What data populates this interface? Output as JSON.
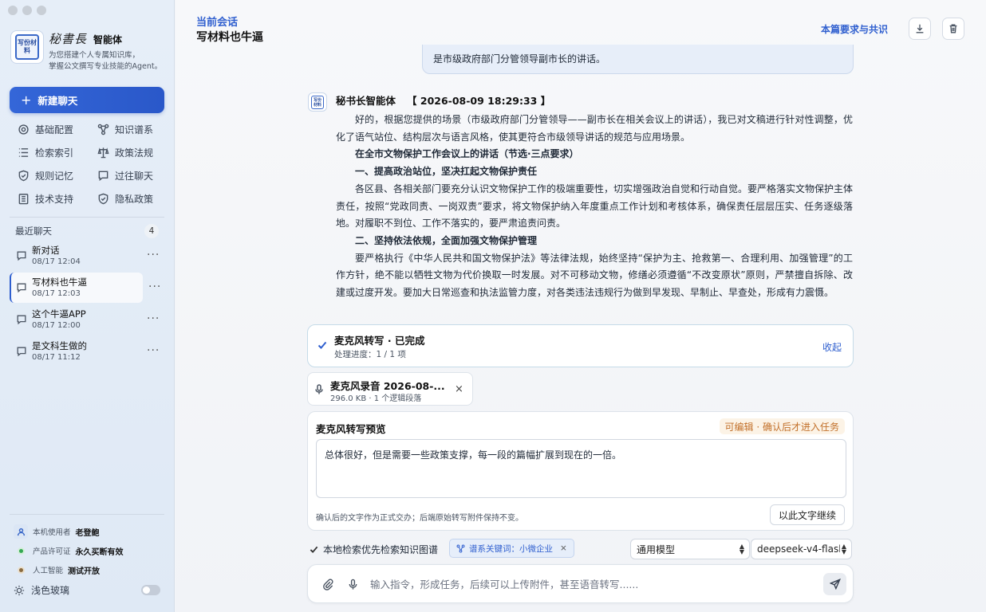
{
  "brand": {
    "logo_text": "写份材料",
    "script_name": "秘書長",
    "agent_label": "智能体",
    "description_line1": "为您搭建个人专属知识库，",
    "description_line2": "掌握公文撰写专业技能的Agent。"
  },
  "sidebar": {
    "new_chat_label": "新建聊天",
    "nav": [
      {
        "label": "基础配置",
        "icon": "gear-icon"
      },
      {
        "label": "知识谱系",
        "icon": "graph-icon"
      },
      {
        "label": "检索索引",
        "icon": "list-icon"
      },
      {
        "label": "政策法规",
        "icon": "scale-icon"
      },
      {
        "label": "规则记忆",
        "icon": "shield-icon"
      },
      {
        "label": "过往聊天",
        "icon": "chat-icon"
      },
      {
        "label": "技术支持",
        "icon": "building-icon"
      },
      {
        "label": "隐私政策",
        "icon": "shield-check-icon"
      }
    ],
    "recent_label": "最近聊天",
    "recent_count": "4",
    "chats": [
      {
        "title": "新对话",
        "time": "08/17 12:04"
      },
      {
        "title": "写材料也牛逼",
        "time": "08/17 12:03"
      },
      {
        "title": "这个牛逼APP",
        "time": "08/17 12:00"
      },
      {
        "title": "是文科生做的",
        "time": "08/17 11:12"
      }
    ],
    "more_label": "···",
    "footer": {
      "user_label": "本机使用者",
      "user_value": "老登鲍",
      "license_label": "产品许可证",
      "license_value": "永久买断有效",
      "ai_label": "人工智能",
      "ai_value": "测试开放",
      "theme_label": "浅色玻璃"
    }
  },
  "header": {
    "subtitle": "当前会话",
    "title": "写材料也牛逼",
    "requirements_link": "本篇要求与共识"
  },
  "conversation": {
    "previous_bubble": "是市级政府部门分管领导副市长的讲话。",
    "assistant_name": "秘书长智能体",
    "timestamp": "【 2026-08-09 18:29:33 】",
    "paragraphs": [
      {
        "text": "好的，根据您提供的场景（市级政府部门分管领导——副市长在相关会议上的讲话），我已对文稿进行针对性调整，优化了语气站位、结构层次与语言风格，使其更符合市级领导讲话的规范与应用场景。",
        "bold": false
      },
      {
        "text": "在全市文物保护工作会议上的讲话（节选·三点要求）",
        "bold": true
      },
      {
        "text": "一、提高政治站位，坚决扛起文物保护责任",
        "bold": true
      },
      {
        "text": "各区县、各相关部门要充分认识文物保护工作的极端重要性，切实增强政治自觉和行动自觉。要严格落实文物保护主体责任，按照“党政同责、一岗双责”要求，将文物保护纳入年度重点工作计划和考核体系，确保责任层层压实、任务逐级落地。对履职不到位、工作不落实的，要严肃追责问责。",
        "bold": false
      },
      {
        "text": "二、坚持依法依规，全面加强文物保护管理",
        "bold": true
      },
      {
        "text": "要严格执行《中华人民共和国文物保护法》等法律法规，始终坚持“保护为主、抢救第一、合理利用、加强管理”的工作方针，绝不能以牺牲文物为代价换取一时发展。对不可移动文物，修缮必须遵循“不改变原状”原则，严禁擅自拆除、改建或过度开发。要加大日常巡查和执法监管力度，对各类违法违规行为做到早发现、早制止、早查处，形成有力震慑。",
        "bold": false
      }
    ]
  },
  "status": {
    "title": "麦克风转写 · 已完成",
    "progress": "处理进度：1 / 1 项",
    "collapse_label": "收起"
  },
  "attachment": {
    "name": "麦克风录音 2026-08-...",
    "meta": "296.0 KB · 1 个逻辑段落",
    "close": "×"
  },
  "preview": {
    "title": "麦克风转写预览",
    "tag": "可编辑 · 确认后才进入任务",
    "text": "总体很好，但是需要一些政策支撑，每一段的篇幅扩展到现在的一倍。",
    "note": "确认后的文字作为正式交办；后端原始转写附件保持不变。",
    "continue_button": "以此文字继续"
  },
  "options": {
    "local_search_label": "本地检索优先检索知识图谱",
    "keyword_chip": "谱系关键词：小微企业",
    "chip_close": "×",
    "model_type": "通用模型",
    "model_name": "deepseek-v4-flash"
  },
  "composer": {
    "placeholder": "输入指令，形成任务，后续可以上传附件，甚至语音转写......"
  }
}
